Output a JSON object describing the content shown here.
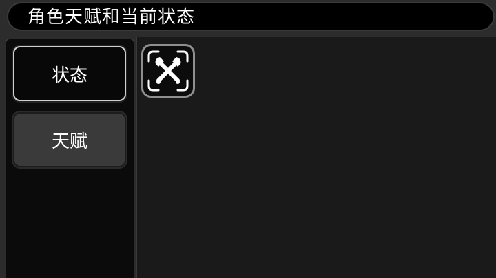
{
  "window": {
    "title": "角色天赋和当前状态"
  },
  "sidebar": {
    "tabs": [
      {
        "label": "状态",
        "active": true
      },
      {
        "label": "天赋",
        "active": false
      }
    ]
  },
  "main": {
    "slots": [
      {
        "icon": "crossed-axes-icon"
      }
    ]
  },
  "colors": {
    "title_bar_bg": "#000000",
    "panel_bg": "#1a1a1a",
    "sidebar_bg": "#0b0b0b",
    "active_tab_border": "#cfcfcf",
    "inactive_tab_bg": "#3a3a3a"
  }
}
